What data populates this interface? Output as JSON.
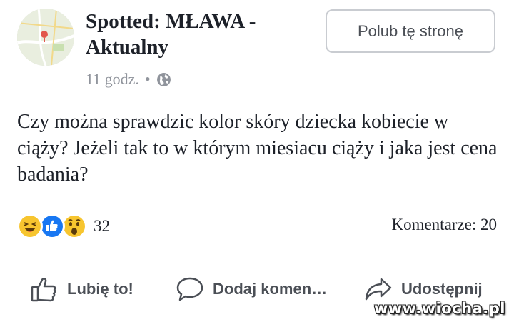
{
  "post": {
    "page_name": "Spotted: MŁAWA - Aktualny",
    "time": "11 godz.",
    "separator": "•",
    "privacy_icon": "globe-icon",
    "follow_label": "Polub tę stronę",
    "text": "Czy można sprawdzic kolor skóry dziecka kobiecie w ciąży? Jeżeli tak to w którym miesiacu ciąży i jaka jest cena badania?"
  },
  "stats": {
    "reactions": [
      "haha-icon",
      "like-icon",
      "wow-icon"
    ],
    "reaction_count": "32",
    "comments_label": "Komentarze: 20"
  },
  "actions": {
    "like": "Lubię to!",
    "comment": "Dodaj komen…",
    "share": "Udostępnij"
  },
  "watermark": "www.wiocha.pl",
  "colors": {
    "like_blue": "#1877f2",
    "reaction_yellow": "#f7c52f",
    "meta_gray": "#90949c",
    "action_gray": "#4b4f56"
  }
}
